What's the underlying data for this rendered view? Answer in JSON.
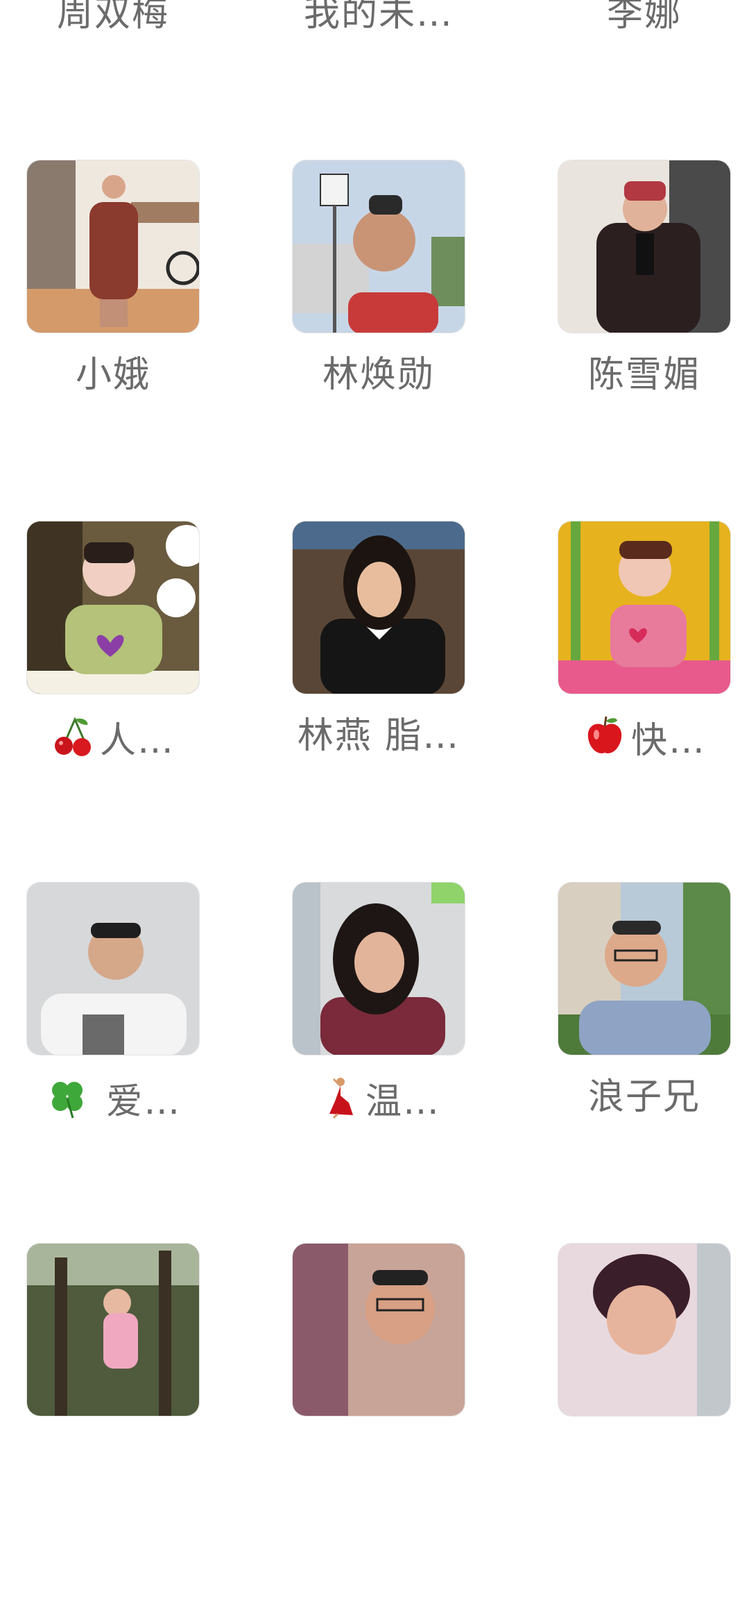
{
  "contacts": [
    {
      "name": "周双梅",
      "emoji": ""
    },
    {
      "name": "我的未…",
      "emoji": ""
    },
    {
      "name": "李娜",
      "emoji": ""
    },
    {
      "name": "小娥",
      "emoji": ""
    },
    {
      "name": "林焕勋",
      "emoji": ""
    },
    {
      "name": "陈雪媚",
      "emoji": ""
    },
    {
      "name": "人…",
      "emoji": "cherries-icon"
    },
    {
      "name": "林燕 脂…",
      "emoji": ""
    },
    {
      "name": "快…",
      "emoji": "apple-icon"
    },
    {
      "name": " 爱…",
      "emoji": "four-leaf-clover-icon"
    },
    {
      "name": "温…",
      "emoji": "dancer-icon"
    },
    {
      "name": "浪子兄",
      "emoji": ""
    },
    {
      "name": "",
      "emoji": ""
    },
    {
      "name": "",
      "emoji": ""
    },
    {
      "name": "",
      "emoji": ""
    }
  ]
}
